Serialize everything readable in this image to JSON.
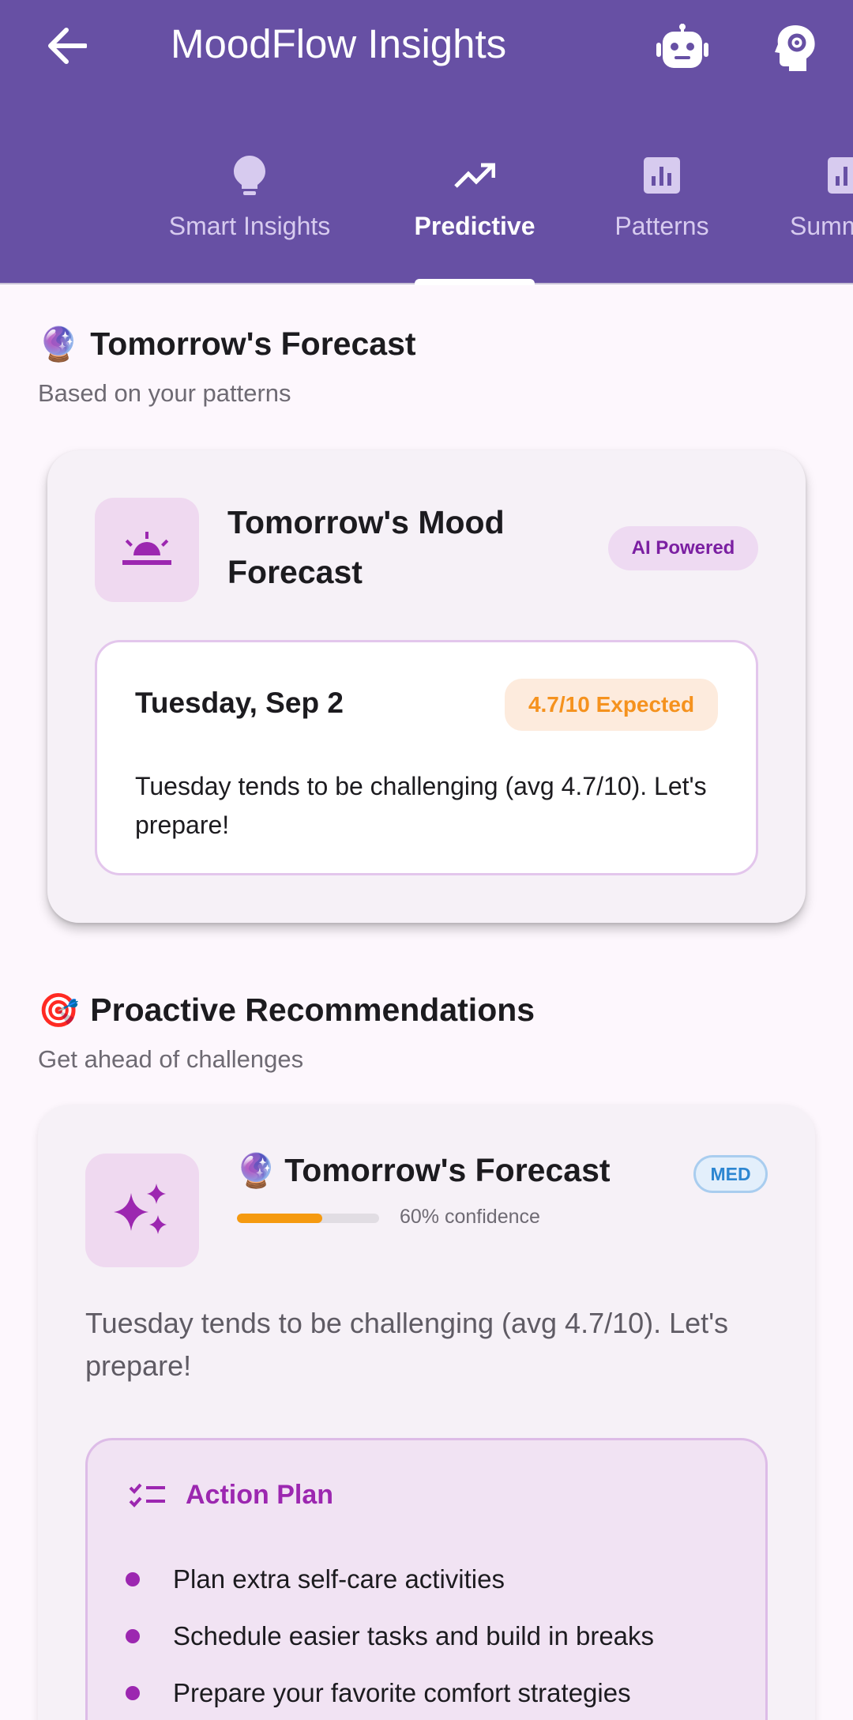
{
  "app_bar": {
    "title": "MoodFlow Insights",
    "back_icon": "arrow-back-icon",
    "robot_icon": "robot-icon",
    "psychology_icon": "psychology-icon"
  },
  "tabs": [
    {
      "label": "Smart Insights",
      "icon": "lightbulb-icon"
    },
    {
      "label": "Predictive",
      "icon": "trending-up-icon",
      "active": true
    },
    {
      "label": "Patterns",
      "icon": "bar-chart-icon"
    },
    {
      "label": "Summ",
      "icon": "bar-chart-icon"
    }
  ],
  "forecast_section": {
    "emoji": "🔮",
    "title": "Tomorrow's Forecast",
    "subtitle": "Based on your patterns"
  },
  "forecast_card": {
    "title": "Tomorrow's Mood Forecast",
    "badge": "AI Powered",
    "day": "Tuesday, Sep 2",
    "expected": "4.7/10 Expected",
    "text": "Tuesday tends to be challenging (avg 4.7/10). Let's prepare!"
  },
  "recommendations_section": {
    "emoji": "🎯",
    "title": "Proactive Recommendations",
    "subtitle": "Get ahead of challenges"
  },
  "recommendation": {
    "emoji": "🔮",
    "title": "Tomorrow's Forecast",
    "priority": "MED",
    "confidence": 0.6,
    "confidence_label": "60% confidence",
    "description": "Tuesday tends to be challenging (avg 4.7/10). Let's prepare!",
    "action_plan": {
      "title": "Action Plan",
      "items": [
        "Plan extra self-care activities",
        "Schedule easier tasks and build in breaks",
        "Prepare your favorite comfort strategies"
      ]
    }
  },
  "colors": {
    "primary": "#6750A4",
    "accent_purple": "#9C27B0",
    "warning_orange": "#F5921E",
    "info_blue": "#2C86D1"
  }
}
